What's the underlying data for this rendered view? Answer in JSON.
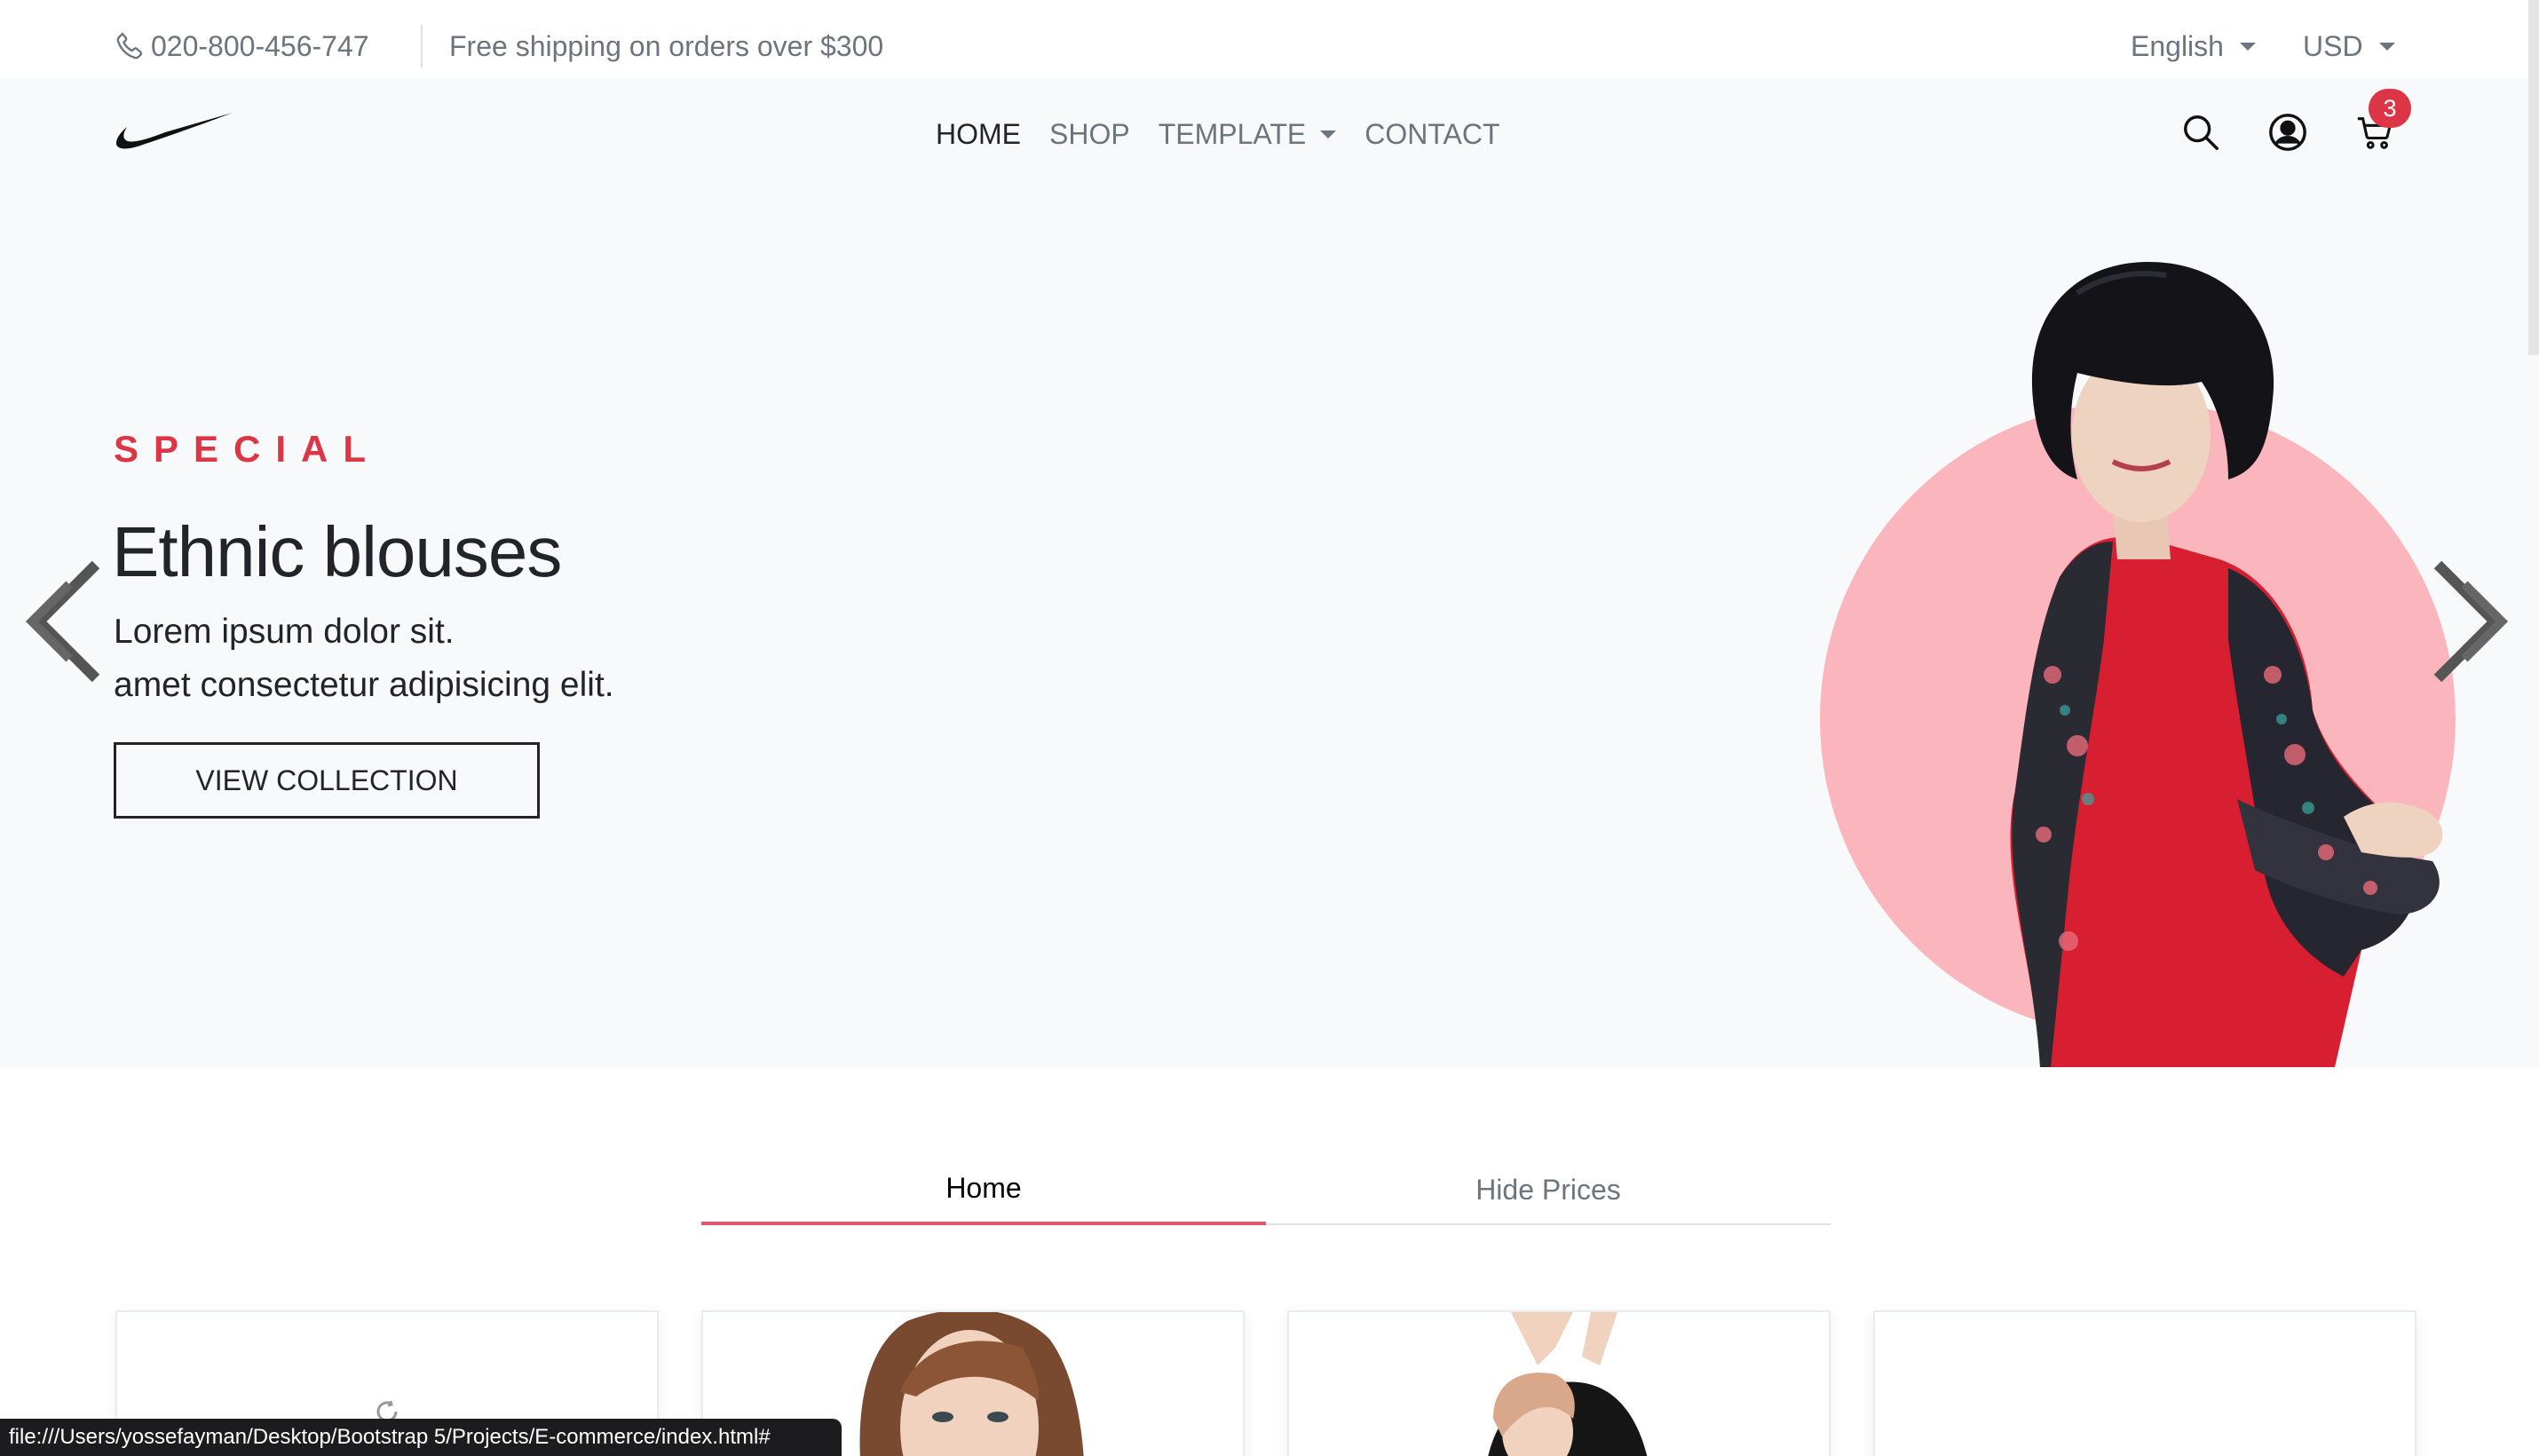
{
  "topbar": {
    "phone": "020-800-456-747",
    "shipping_note": "Free shipping on orders over $300",
    "language": "English",
    "currency": "USD"
  },
  "nav": {
    "logo": "swoosh-logo",
    "links": [
      {
        "label": "HOME",
        "active": true
      },
      {
        "label": "SHOP",
        "active": false
      },
      {
        "label": "TEMPLATE",
        "active": false,
        "has_dropdown": true
      },
      {
        "label": "CONTACT",
        "active": false
      }
    ],
    "icons": [
      "search-icon",
      "user-icon",
      "cart-icon"
    ],
    "cart_count": "3"
  },
  "hero": {
    "eyebrow": "SPECIAL",
    "title": "Ethnic blouses",
    "line1": "Lorem ipsum dolor sit.",
    "line2": "amet consectetur adipisicing elit.",
    "button": "VIEW COLLECTION"
  },
  "tabs": [
    {
      "label": "Home",
      "active": true
    },
    {
      "label": "Hide Prices",
      "active": false
    }
  ],
  "status_url": "file:///Users/yossefayman/Desktop/Bootstrap 5/Projects/E-commerce/index.html#",
  "colors": {
    "accent": "#dc3545",
    "tab_underline": "#e0556b",
    "hero_bg": "#f8f9fa",
    "circle": "#fbb6bd"
  }
}
